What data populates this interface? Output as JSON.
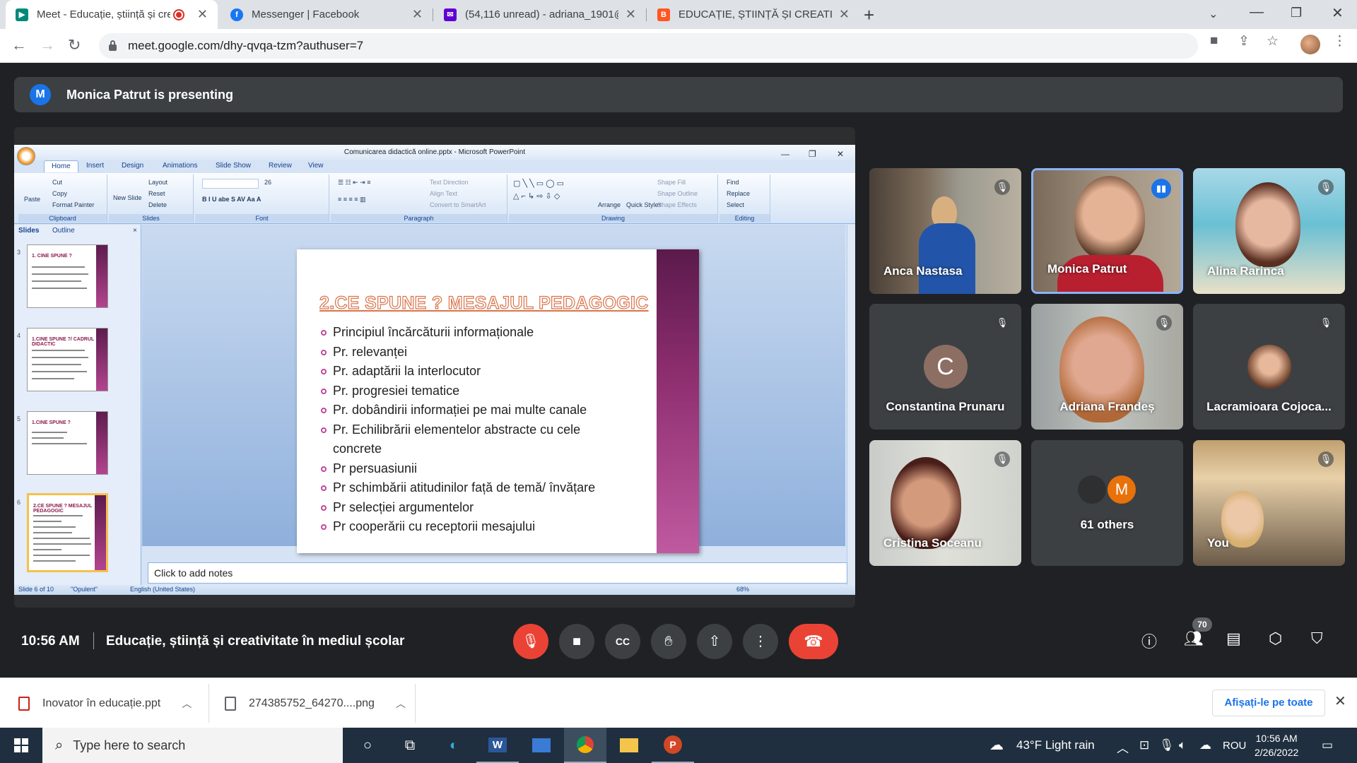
{
  "browser": {
    "tabs": [
      {
        "title": "Meet - Educație, știință și cre",
        "favicon": "meet-icon",
        "color": "#00897b"
      },
      {
        "title": "Messenger | Facebook",
        "favicon": "facebook-icon",
        "color": "#1877f2"
      },
      {
        "title": "(54,116 unread) - adriana_1901@",
        "favicon": "yahoo-mail-icon",
        "color": "#6001d2"
      },
      {
        "title": "EDUCAȚIE, ȘTIINȚĂ ȘI CREATIVIT",
        "favicon": "blogger-icon",
        "color": "#ff5722"
      }
    ],
    "url": "meet.google.com/dhy-qvqa-tzm?authuser=7"
  },
  "meet": {
    "presenter_initial": "M",
    "presenter_banner": "Monica Patrut is presenting",
    "time": "10:56 AM",
    "meeting_title": "Educație, știință și creativitate în mediul școlar",
    "participants_count": "70",
    "tiles": [
      {
        "name": "Anca Nastasa",
        "muted": true
      },
      {
        "name": "Monica Patrut",
        "muted": false,
        "speaking": true
      },
      {
        "name": "Alina Rarinca",
        "muted": true
      },
      {
        "name": "Constantina Prunaru",
        "initial": "C",
        "muted": true
      },
      {
        "name": "Adriana Frandeș",
        "muted": true
      },
      {
        "name": "Lacramioara Cojoca...",
        "muted": true
      },
      {
        "name": "Cristina Soceanu",
        "muted": true
      },
      {
        "name": "61 others",
        "initial": "M"
      },
      {
        "name": "You",
        "muted": true
      }
    ]
  },
  "powerpoint": {
    "window_title": "Comunicarea didactică online.pptx - Microsoft PowerPoint",
    "tabs": [
      "Home",
      "Insert",
      "Design",
      "Animations",
      "Slide Show",
      "Review",
      "View"
    ],
    "groups": [
      "Clipboard",
      "Slides",
      "Font",
      "Paragraph",
      "Drawing",
      "Editing"
    ],
    "ribbon": {
      "paste": "Paste",
      "cut": "Cut",
      "copy": "Copy",
      "format_painter": "Format Painter",
      "new_slide": "New Slide",
      "layout": "Layout",
      "reset": "Reset",
      "delete": "Delete",
      "font_size": "26",
      "text_direction": "Text Direction",
      "align_text": "Align Text",
      "convert_smartart": "Convert to SmartArt",
      "arrange": "Arrange",
      "quick_styles": "Quick Styles",
      "shape_fill": "Shape Fill",
      "shape_outline": "Shape Outline",
      "shape_effects": "Shape Effects",
      "find": "Find",
      "replace": "Replace",
      "select": "Select"
    },
    "pane_tabs": [
      "Slides",
      "Outline"
    ],
    "thumbnails": [
      {
        "num": "3",
        "title": "1. CINE SPUNE ?"
      },
      {
        "num": "4",
        "title": "1.CINE SPUNE ?/ CADRUL DIDACTIC"
      },
      {
        "num": "5",
        "title": "1.CINE SPUNE ?"
      },
      {
        "num": "6",
        "title": "2.CE SPUNE ? MESAJUL PEDAGOGIC"
      }
    ],
    "slide": {
      "title": "2.CE SPUNE ? MESAJUL PEDAGOGIC",
      "bullets": [
        "Principiul încărcăturii informaționale",
        "Pr. relevanței",
        "Pr. adaptării la interlocutor",
        "Pr. progresiei tematice",
        "Pr. dobândirii informației pe mai multe canale",
        "Pr. Echilibrării elementelor abstracte cu cele concrete",
        "Pr persuasiunii",
        "Pr schimbării atitudinilor față de temă/ învățare",
        "Pr selecției argumentelor",
        "Pr cooperării cu receptorii mesajului"
      ]
    },
    "notes_placeholder": "Click to add notes",
    "status": {
      "slide": "Slide 6 of 10",
      "theme": "\"Opulent\"",
      "language": "English (United States)",
      "zoom": "68%"
    }
  },
  "downloads": {
    "items": [
      {
        "name": "Inovator în educație.ppt"
      },
      {
        "name": "274385752_64270....png"
      }
    ],
    "show_all": "Afișați-le pe toate"
  },
  "taskbar": {
    "search_placeholder": "Type here to search",
    "weather": "43°F  Light rain",
    "lang": "ROU",
    "time": "10:56 AM",
    "date": "2/26/2022"
  }
}
